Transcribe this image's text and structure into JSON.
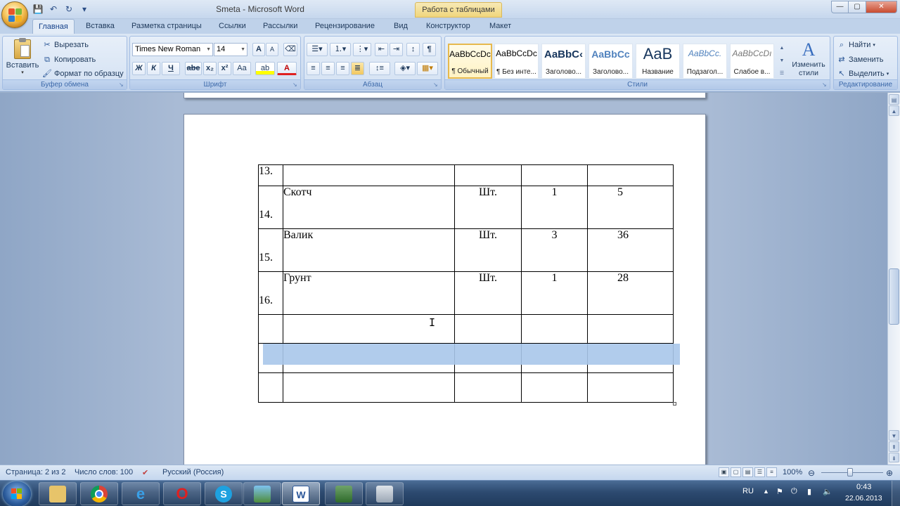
{
  "window": {
    "title": "Smeta - Microsoft Word",
    "context_tab": "Работа с таблицами",
    "controls": {
      "minimize": "—",
      "maximize": "▢",
      "close": "✕"
    }
  },
  "quick_access": {
    "save": "💾",
    "undo": "↶",
    "redo": "↻",
    "customize": "▾"
  },
  "tabs": [
    "Главная",
    "Вставка",
    "Разметка страницы",
    "Ссылки",
    "Рассылки",
    "Рецензирование",
    "Вид",
    "Конструктор",
    "Макет"
  ],
  "clipboard": {
    "paste": "Вставить",
    "cut": "Вырезать",
    "copy": "Копировать",
    "format_painter": "Формат по образцу",
    "label": "Буфер обмена"
  },
  "font": {
    "name": "Times New Roman",
    "size": "14",
    "grow": "A",
    "shrink": "A",
    "bold": "Ж",
    "italic": "К",
    "underline": "Ч",
    "strike": "abe",
    "subscript": "x₂",
    "superscript": "x²",
    "case": "Aa",
    "label": "Шрифт"
  },
  "paragraph": {
    "label": "Абзац",
    "pilcrow": "¶"
  },
  "styles": {
    "label": "Стили",
    "items": [
      {
        "sample": "AaBbCcDc",
        "name": "¶ Обычный"
      },
      {
        "sample": "AaBbCcDc",
        "name": "¶ Без инте..."
      },
      {
        "sample": "AaBbC‹",
        "name": "Заголово..."
      },
      {
        "sample": "AaBbCc",
        "name": "Заголово..."
      },
      {
        "sample": "AaB",
        "name": "Название"
      },
      {
        "sample": "AaBbCc.",
        "name": "Подзагол..."
      },
      {
        "sample": "AaBbCcDı",
        "name": "Слабое в..."
      }
    ],
    "change_styles": "Изменить стили"
  },
  "editing": {
    "label": "Редактирование",
    "find": "Найти",
    "replace": "Заменить",
    "select": "Выделить"
  },
  "table": {
    "rows": [
      {
        "num": "13.",
        "name": "",
        "unit": "",
        "qty": "",
        "price": ""
      },
      {
        "num": "14.",
        "name": "Скотч",
        "unit": "Шт.",
        "qty": "1",
        "price": "5"
      },
      {
        "num": "15.",
        "name": "Валик",
        "unit": "Шт.",
        "qty": "3",
        "price": "36"
      },
      {
        "num": "16.",
        "name": "Грунт",
        "unit": "Шт.",
        "qty": "1",
        "price": "28"
      },
      {
        "num": "",
        "name": "",
        "unit": "",
        "qty": "",
        "price": ""
      },
      {
        "num": "",
        "name": "",
        "unit": "",
        "qty": "",
        "price": ""
      },
      {
        "num": "",
        "name": "",
        "unit": "",
        "qty": "",
        "price": ""
      }
    ]
  },
  "statusbar": {
    "page": "Страница: 2 из 2",
    "words": "Число слов: 100",
    "language": "Русский (Россия)",
    "zoom": "100%"
  },
  "taskbar": {
    "lang": "RU",
    "time": "0:43",
    "date": "22.06.2013"
  },
  "colors": {
    "selection": "#a8c6ea",
    "ribbon": "#dbe6f4",
    "taskbar": "#2d4a70"
  }
}
